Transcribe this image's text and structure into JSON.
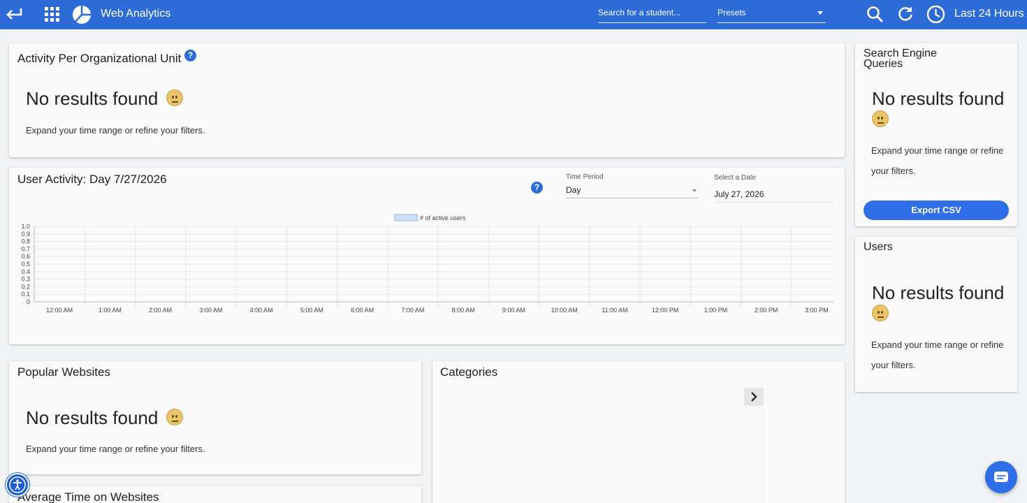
{
  "header": {
    "app_title": "Web Analytics",
    "search_placeholder": "Search for a student...",
    "presets_label": "Presets",
    "time_range": "Last 24 Hours"
  },
  "org_unit": {
    "title": "Activity Per Organizational Unit",
    "no_results": "No results found",
    "hint": "Expand your time range or refine your filters."
  },
  "user_activity": {
    "title": "User Activity: Day 7/27/2026",
    "time_period_label": "Time Period",
    "time_period_value": "Day",
    "date_label": "Select a Date",
    "date_value": "July 27, 2026"
  },
  "chart_data": {
    "type": "bar",
    "series": [
      {
        "name": "# of active users",
        "values": [
          0,
          0,
          0,
          0,
          0,
          0,
          0,
          0,
          0,
          0,
          0,
          0,
          0,
          0,
          0,
          0
        ]
      }
    ],
    "categories": [
      "12:00 AM",
      "1:00 AM",
      "2:00 AM",
      "3:00 AM",
      "4:00 AM",
      "5:00 AM",
      "6:00 AM",
      "7:00 AM",
      "8:00 AM",
      "9:00 AM",
      "10:00 AM",
      "11:00 AM",
      "12:00 PM",
      "1:00 PM",
      "2:00 PM",
      "3:00 PM"
    ],
    "y_ticks": [
      "1.0",
      "0.9",
      "0.8",
      "0.7",
      "0.6",
      "0.5",
      "0.4",
      "0.3",
      "0.2",
      "0.1",
      "0"
    ],
    "ylim": [
      0,
      1
    ],
    "legend_position": "top-center",
    "grid": true
  },
  "popular_websites": {
    "title": "Popular Websites",
    "no_results": "No results found",
    "hint": "Expand your time range or refine your filters."
  },
  "categories_card": {
    "title": "Categories"
  },
  "avg_time": {
    "title": "Average Time on Websites"
  },
  "search_queries": {
    "title_line1": "Search Engine",
    "title_line2": "Queries",
    "no_results": "No results found",
    "hint_line1": "Expand your time range or refine",
    "hint_line2": "your filters.",
    "export_label": "Export CSV"
  },
  "users": {
    "title": "Users",
    "no_results": "No results found",
    "hint_line1": "Expand your time range or refine",
    "hint_line2": "your filters."
  },
  "colors": {
    "brand": "#2d6bd6",
    "legend_fill": "#cfe0f7"
  }
}
